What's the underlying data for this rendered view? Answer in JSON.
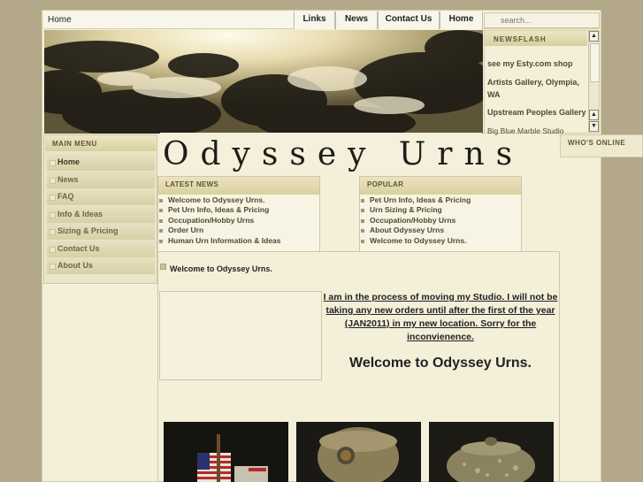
{
  "topbar": {
    "breadcrumb": "Home",
    "nav": [
      {
        "label": "Links"
      },
      {
        "label": "News"
      },
      {
        "label": "Contact Us"
      },
      {
        "label": "Home"
      }
    ],
    "search_placeholder": "search..."
  },
  "newsflash": {
    "heading": "NEWSFLASH",
    "items": [
      "see my Esty.com shop",
      "Artists Gallery, Olympia, WA",
      "Upstream Peoples Gallery",
      "Big Blue Marble Studio"
    ]
  },
  "whos_online": {
    "heading": "WHO'S ONLINE"
  },
  "main_menu": {
    "heading": "MAIN MENU",
    "items": [
      {
        "label": "Home"
      },
      {
        "label": "News"
      },
      {
        "label": "FAQ"
      },
      {
        "label": "Info & Ideas"
      },
      {
        "label": "Sizing & Pricing"
      },
      {
        "label": "Contact Us"
      },
      {
        "label": "About Us"
      }
    ]
  },
  "logo_text": "Odyssey Urns",
  "latest_news": {
    "heading": "LATEST NEWS",
    "items": [
      "Welcome to Odyssey Urns.",
      "Pet Urn Info, Ideas & Pricing",
      "Occupation/Hobby Urns",
      "Order Urn",
      "Human Urn Information & Ideas"
    ]
  },
  "popular": {
    "heading": "POPULAR",
    "items": [
      "Pet Urn Info, Ideas & Pricing",
      "Urn Sizing & Pricing",
      "Occupation/Hobby Urns",
      "About Odyssey Urns",
      "Welcome to Odyssey Urns."
    ]
  },
  "article": {
    "title": "Welcome to Odyssey Urns.",
    "notice": "I am in the process of moving my Studio. I will not be taking any new orders until after the first of the year (JAN2011) in my new location. Sorry for the inconvienence.",
    "heading": "Welcome to Odyssey Urns."
  },
  "colors": {
    "page_bg": "#b3a88a",
    "panel_bg": "#f3efd9",
    "header_gold": "#d8cf9f"
  }
}
